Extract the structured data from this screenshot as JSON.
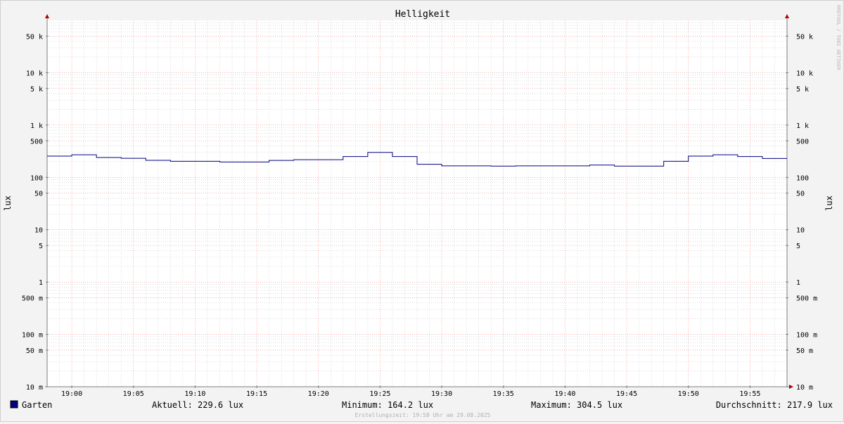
{
  "chart_data": {
    "type": "line",
    "title": "Helligkeit",
    "ylabel_left": "lux",
    "ylabel_right": "lux",
    "y_scale": "log",
    "ylim": [
      0.01,
      100000
    ],
    "y_ticks": [
      {
        "value": 50000,
        "label": "50 k"
      },
      {
        "value": 10000,
        "label": "10 k"
      },
      {
        "value": 5000,
        "label": "5 k"
      },
      {
        "value": 1000,
        "label": "1 k"
      },
      {
        "value": 500,
        "label": "500"
      },
      {
        "value": 100,
        "label": "100"
      },
      {
        "value": 50,
        "label": "50"
      },
      {
        "value": 10,
        "label": "10"
      },
      {
        "value": 5,
        "label": "5"
      },
      {
        "value": 1,
        "label": "1"
      },
      {
        "value": 0.5,
        "label": "500 m"
      },
      {
        "value": 0.1,
        "label": "100 m"
      },
      {
        "value": 0.05,
        "label": "50 m"
      },
      {
        "value": 0.01,
        "label": "10 m"
      }
    ],
    "x_ticks": [
      "19:00",
      "19:05",
      "19:10",
      "19:15",
      "19:20",
      "19:25",
      "19:30",
      "19:35",
      "19:40",
      "19:45",
      "19:50",
      "19:55"
    ],
    "xlim": [
      "18:58",
      "19:58"
    ],
    "grid": true,
    "series": [
      {
        "name": "Garten",
        "color": "#000080",
        "step": true,
        "x": [
          "18:58",
          "19:00",
          "19:02",
          "19:04",
          "19:06",
          "19:08",
          "19:10",
          "19:12",
          "19:14",
          "19:16",
          "19:18",
          "19:20",
          "19:22",
          "19:24",
          "19:26",
          "19:28",
          "19:30",
          "19:32",
          "19:34",
          "19:36",
          "19:38",
          "19:40",
          "19:42",
          "19:44",
          "19:46",
          "19:48",
          "19:50",
          "19:52",
          "19:54",
          "19:56"
        ],
        "values": [
          255,
          270,
          240,
          232,
          212,
          203,
          203,
          197,
          197,
          211,
          218,
          218,
          250,
          300,
          250,
          178,
          166,
          166,
          164,
          166,
          166,
          166,
          172,
          164,
          164,
          203,
          255,
          270,
          250,
          230
        ]
      }
    ]
  },
  "legend": {
    "series_name": "Garten",
    "series_color": "#000080",
    "aktuell": "Aktuell: 229.6 lux",
    "minimum": "Minimum: 164.2 lux",
    "maximum": "Maximum: 304.5 lux",
    "durchschnitt": "Durchschnitt: 217.9 lux"
  },
  "footer": "Erstellungszeit: 19:58 Uhr am 29.08.2025",
  "watermark": "RRDTOOL / TOBI OETIKER",
  "colors": {
    "axis": "#7f7f7f",
    "arrow": "#b00000",
    "major_grid": "#f08080",
    "minor_grid": "#c8c8c8"
  }
}
